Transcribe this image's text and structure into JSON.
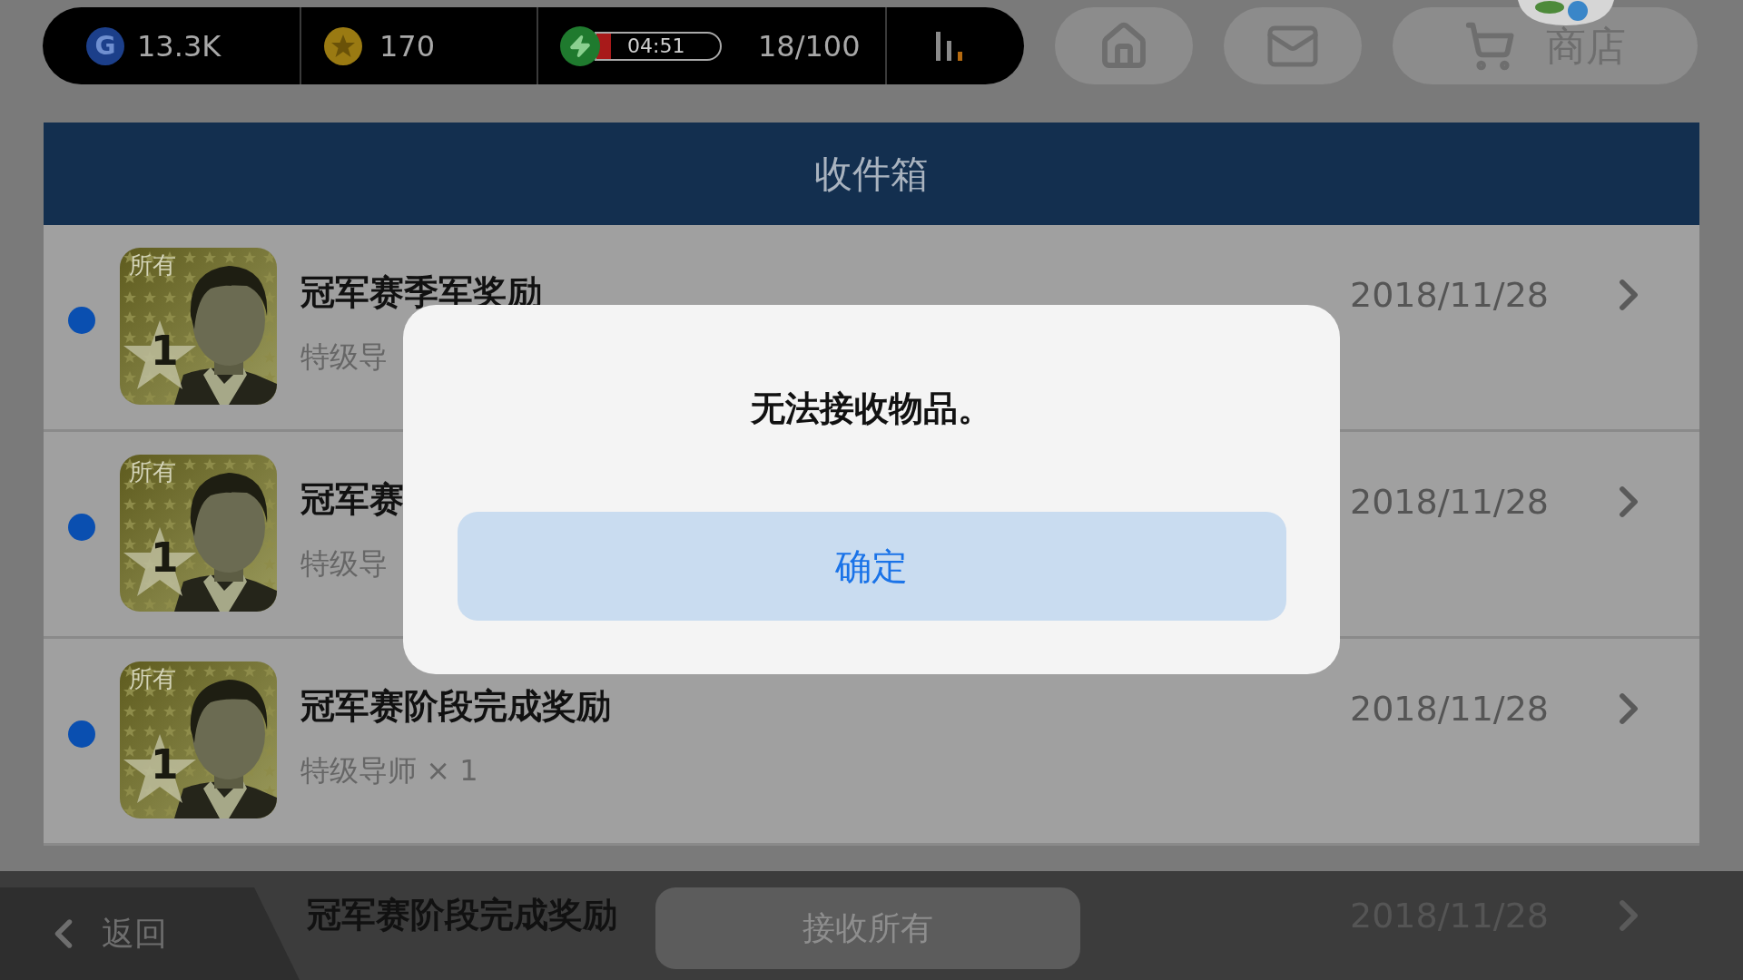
{
  "top_bar": {
    "currency_icon": "G",
    "currency": "13.3K",
    "coins": "170",
    "energy": {
      "timer": "04:51",
      "level": 0.12,
      "count": "18/100"
    }
  },
  "nav_buttons": [
    {
      "kind": "home"
    },
    {
      "kind": "mail"
    },
    {
      "kind": "shop",
      "label": "商店"
    }
  ],
  "title": "收件箱",
  "messages": [
    {
      "badge": "所有",
      "rank": "1",
      "title": "冠军赛季军奖励",
      "subtitle": "特级导",
      "date": "2018/11/28",
      "unread": true
    },
    {
      "badge": "所有",
      "rank": "1",
      "title": "冠军赛",
      "subtitle": "特级导",
      "date": "2018/11/28",
      "unread": true
    },
    {
      "badge": "所有",
      "rank": "1",
      "title": "冠军赛阶段完成奖励",
      "subtitle": "特级导师 × 1",
      "date": "2018/11/28",
      "unread": true
    },
    {
      "title": "冠军赛阶段完成奖励",
      "date": "2018/11/28"
    }
  ],
  "dialog": {
    "message": "无法接收物品。",
    "confirm": "确定"
  },
  "bottom_bar": {
    "back": "返回",
    "receive_all": "接收所有"
  }
}
